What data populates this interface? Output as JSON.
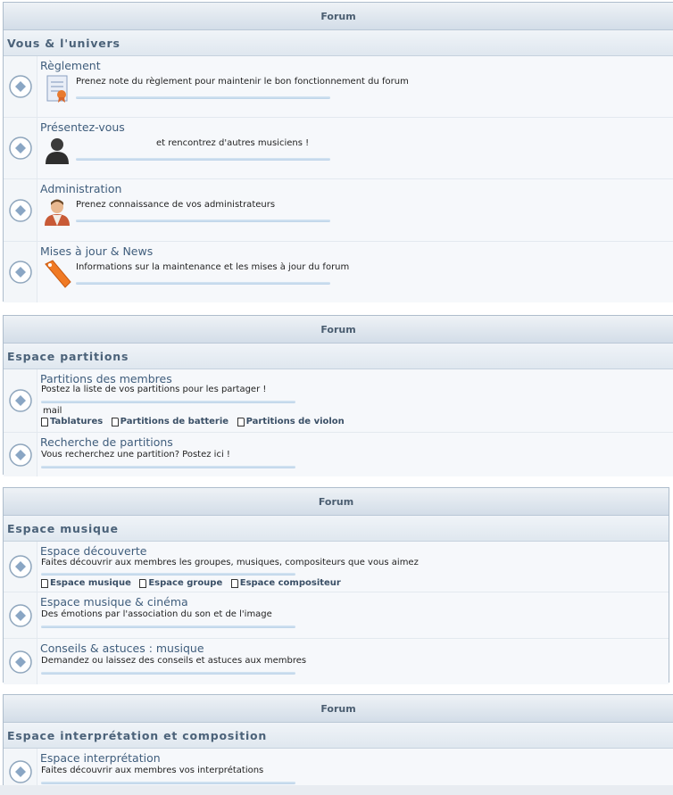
{
  "sections": [
    {
      "header": "Forum",
      "category": "Vous & l'univers",
      "forums": [
        {
          "title": "Règlement",
          "desc": "Prenez note du règlement pour maintenir le bon fonctionnement du forum",
          "image": "certificate-icon"
        },
        {
          "title": "Présentez-vous",
          "desc": "et rencontrez d'autres musiciens !",
          "image": "user-silhouette-icon"
        },
        {
          "title": "Administration",
          "desc": "Prenez connaissance de vos administrateurs",
          "image": "admin-avatar-icon"
        },
        {
          "title": "Mises à jour & News",
          "desc": "Informations sur la maintenance et les mises à jour du forum",
          "image": "tag-icon"
        }
      ]
    },
    {
      "header": "Forum",
      "category": "Espace partitions",
      "forums": [
        {
          "title": "Partitions des membres",
          "desc": "Postez la liste de vos partitions pour les partager !",
          "extra": "mail",
          "sublinks": [
            "Tablatures",
            "Partitions de batterie",
            "Partitions de violon"
          ]
        },
        {
          "title": "Recherche de partitions",
          "desc": "Vous recherchez une partition? Postez ici !"
        }
      ]
    },
    {
      "header": "Forum",
      "category": "Espace musique",
      "forums": [
        {
          "title": "Espace découverte",
          "desc": "Faites découvrir aux membres les groupes, musiques, compositeurs que vous aimez",
          "sublinks": [
            "Espace musique",
            "Espace groupe",
            "Espace compositeur"
          ]
        },
        {
          "title": "Espace musique & cinéma",
          "desc": "Des émotions par l'association du son et de l'image"
        },
        {
          "title": "Conseils & astuces : musique",
          "desc": "Demandez ou laissez des conseils et astuces aux membres"
        }
      ]
    },
    {
      "header": "Forum",
      "category": "Espace interprétation et composition",
      "forums": [
        {
          "title": "Espace interprétation",
          "desc": "Faites découvrir aux membres vos interprétations"
        }
      ]
    }
  ],
  "colors": {
    "accent": "#3f5d7c",
    "header_bg": "#d3dde8",
    "border": "#aebdcc"
  }
}
